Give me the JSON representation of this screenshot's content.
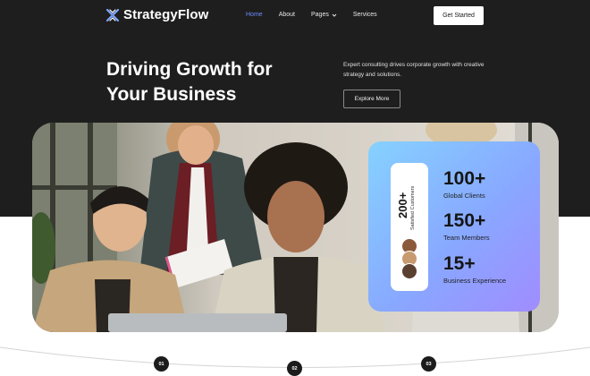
{
  "brand": {
    "name": "StrategyFlow"
  },
  "nav": {
    "items": [
      {
        "label": "Home",
        "active": true
      },
      {
        "label": "About"
      },
      {
        "label": "Pages",
        "dropdown": true
      },
      {
        "label": "Services"
      }
    ],
    "cta_label": "Get Started"
  },
  "hero": {
    "headline_line1": "Driving Growth for",
    "headline_line2": "Your Business",
    "subtext": "Expert consulting drives corporate growth with creative strategy and solutions.",
    "explore_label": "Explore More"
  },
  "stats_card": {
    "satisfied_count": "200+",
    "satisfied_label": "Satisfied Customers",
    "stats": [
      {
        "value": "100+",
        "label": "Global Clients"
      },
      {
        "value": "150+",
        "label": "Team Members"
      },
      {
        "value": "15+",
        "label": "Business Experience"
      }
    ]
  },
  "steps": [
    "01",
    "02",
    "03"
  ],
  "colors": {
    "dark_background": "#1e1e1e",
    "nav_active": "#6d8bff",
    "card_gradient_start": "#86d2ff",
    "card_gradient_end": "#a08cff"
  },
  "icons": {
    "logo": "x-cross-logo-icon",
    "dropdown": "chevron-down-icon"
  }
}
